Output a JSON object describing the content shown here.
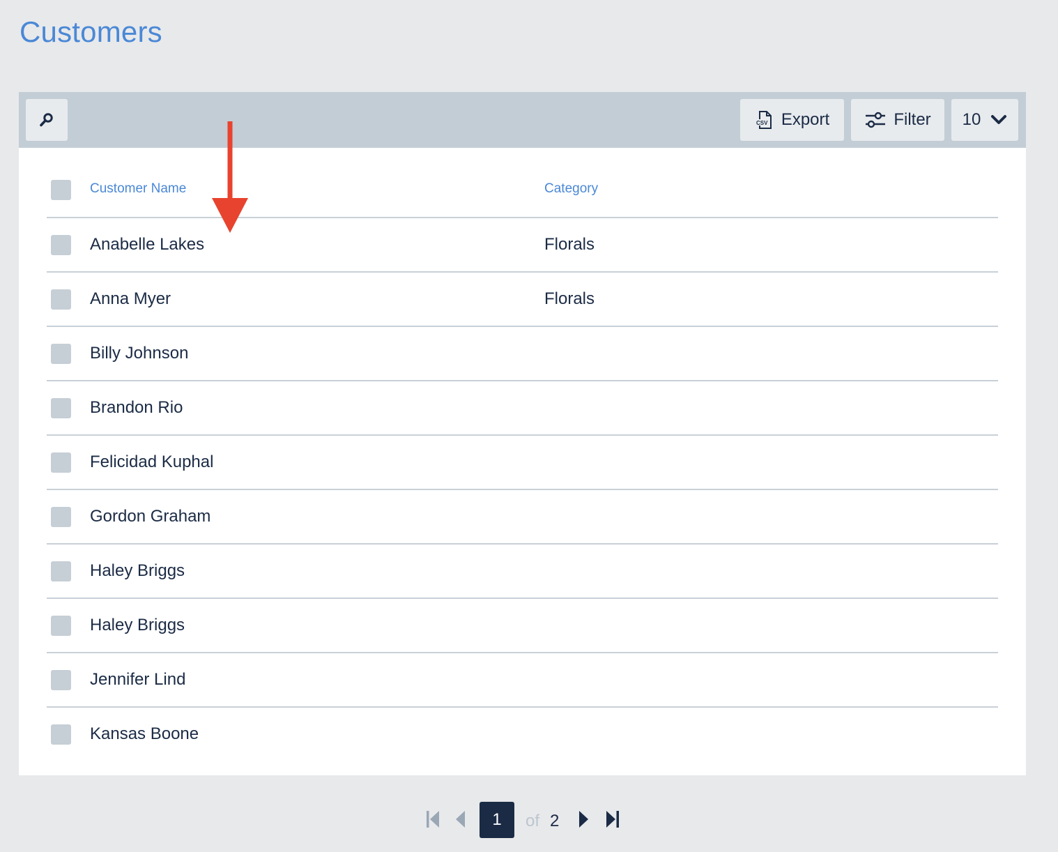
{
  "page": {
    "title": "Customers"
  },
  "toolbar": {
    "search_icon": "search-icon",
    "export_label": "Export",
    "export_icon": "csv-file-icon",
    "filter_label": "Filter",
    "filter_icon": "sliders-icon",
    "page_size": "10",
    "page_size_icon": "chevron-down-icon"
  },
  "table": {
    "columns": {
      "name": "Customer Name",
      "category": "Category"
    },
    "rows": [
      {
        "name": "Anabelle Lakes",
        "category": "Florals"
      },
      {
        "name": "Anna Myer",
        "category": "Florals"
      },
      {
        "name": "Billy Johnson",
        "category": ""
      },
      {
        "name": "Brandon Rio",
        "category": ""
      },
      {
        "name": "Felicidad Kuphal",
        "category": ""
      },
      {
        "name": "Gordon Graham",
        "category": ""
      },
      {
        "name": "Haley Briggs",
        "category": ""
      },
      {
        "name": "Haley Briggs",
        "category": ""
      },
      {
        "name": "Jennifer Lind",
        "category": ""
      },
      {
        "name": "Kansas Boone",
        "category": ""
      }
    ]
  },
  "pagination": {
    "current": "1",
    "of_label": "of",
    "total": "2"
  },
  "annotation": {
    "icon": "red-down-arrow",
    "color": "#e8432e"
  },
  "colors": {
    "accent": "#4a88d6",
    "text": "#1b2b45",
    "toolbar": "#c3cdd5",
    "background": "#e8e9eb"
  }
}
